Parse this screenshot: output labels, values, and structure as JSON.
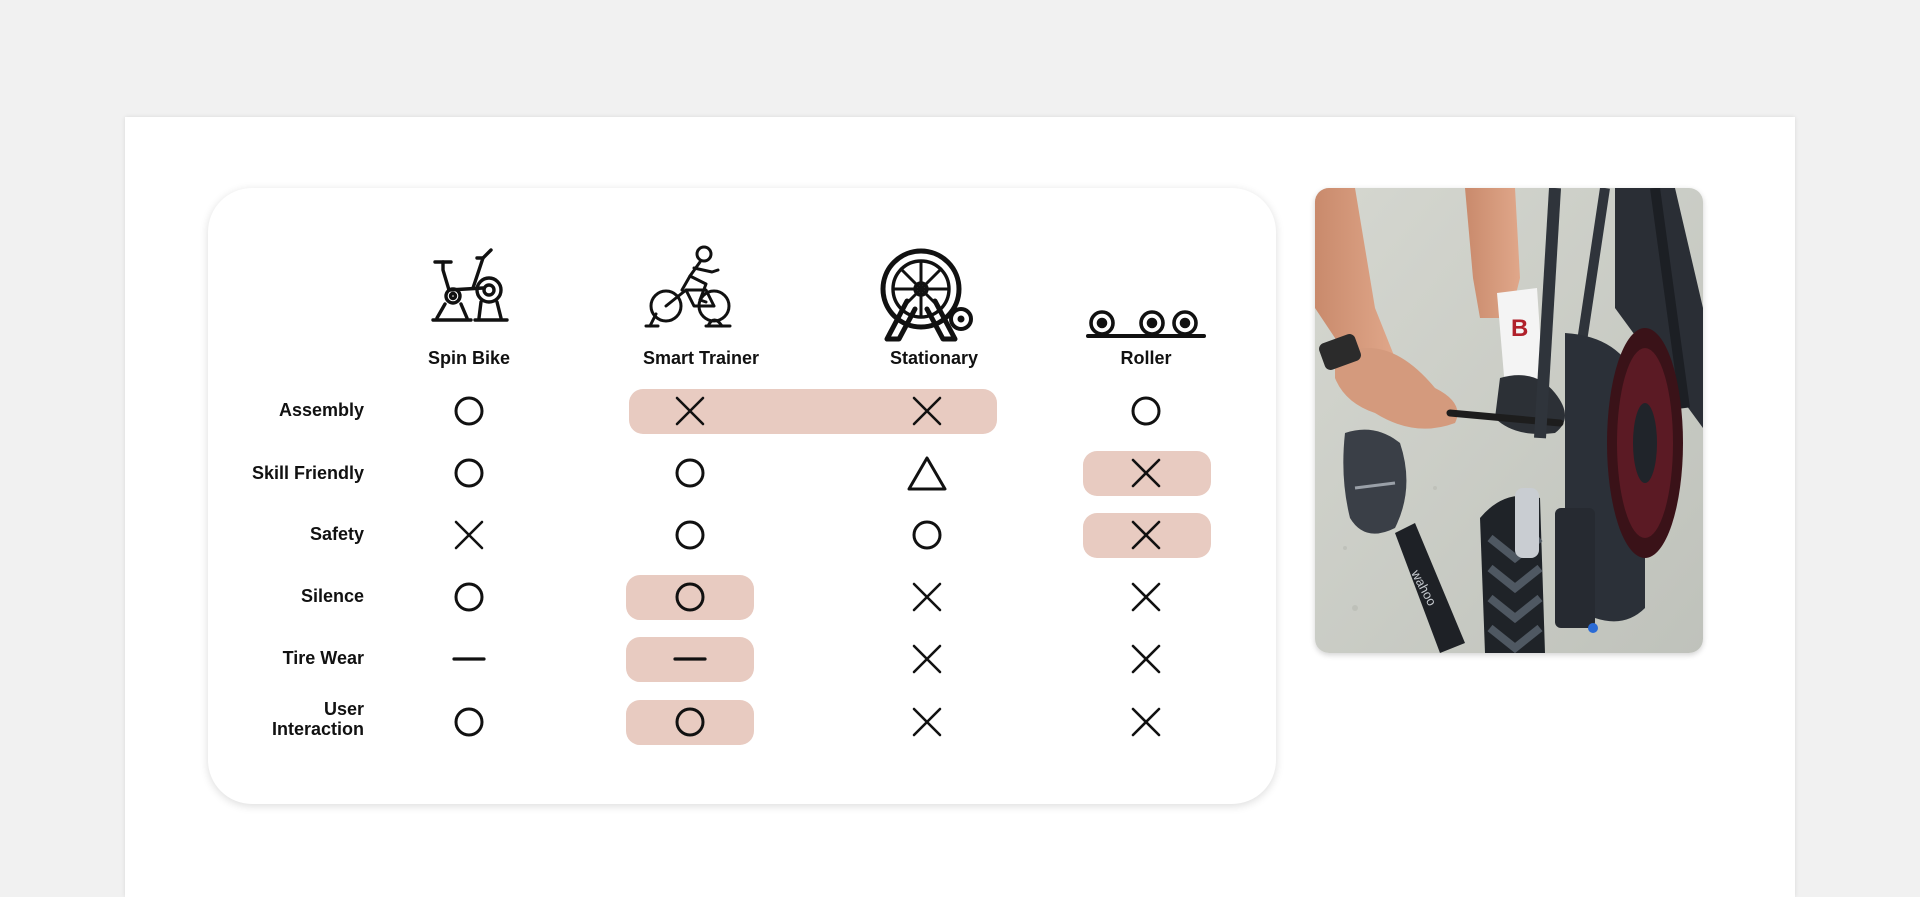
{
  "table": {
    "columns": [
      {
        "name": "Spin Bike",
        "icon": "spin-bike-icon"
      },
      {
        "name": "Smart Trainer",
        "icon": "smart-trainer-icon"
      },
      {
        "name": "Stationary",
        "icon": "stationary-icon"
      },
      {
        "name": "Roller",
        "icon": "roller-icon"
      }
    ],
    "rows": [
      {
        "label": "Assembly",
        "marks": [
          "circle",
          "cross",
          "cross",
          "circle"
        ],
        "highlighted": [
          false,
          true,
          true,
          false
        ]
      },
      {
        "label": "Skill Friendly",
        "marks": [
          "circle",
          "circle",
          "triangle",
          "cross"
        ],
        "highlighted": [
          false,
          false,
          false,
          true
        ]
      },
      {
        "label": "Safety",
        "marks": [
          "cross",
          "circle",
          "circle",
          "cross"
        ],
        "highlighted": [
          false,
          false,
          false,
          true
        ]
      },
      {
        "label": "Silence",
        "marks": [
          "circle",
          "circle",
          "cross",
          "cross"
        ],
        "highlighted": [
          false,
          true,
          false,
          false
        ]
      },
      {
        "label": "Tire Wear",
        "marks": [
          "dash",
          "dash",
          "cross",
          "cross"
        ],
        "highlighted": [
          false,
          true,
          false,
          false
        ]
      },
      {
        "label": "User\nInteraction",
        "marks": [
          "circle",
          "circle",
          "cross",
          "cross"
        ],
        "highlighted": [
          false,
          true,
          false,
          false
        ]
      }
    ],
    "highlight_color": "#e8cbc1"
  },
  "photo": {
    "subject": "cyclist-mounting-bike-on-smart-trainer",
    "sock_logo": "B",
    "trainer_brand": "wahoo"
  }
}
